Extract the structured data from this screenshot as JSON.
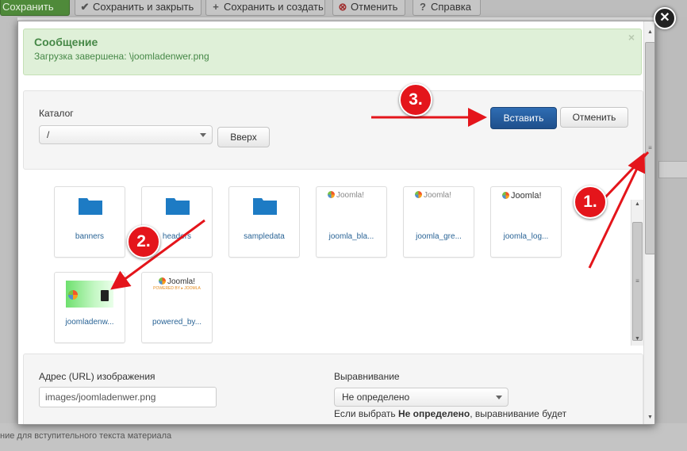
{
  "toolbar": {
    "save": "Сохранить",
    "save_close": "Сохранить и закрыть",
    "save_create": "Сохранить и создать",
    "cancel": "Отменить",
    "help": "Справка"
  },
  "background": {
    "bottom_caption": "ние для вступительного текста материала"
  },
  "message": {
    "title": "Сообщение",
    "text": "Загрузка завершена: \\joomladenwer.png",
    "close": "×"
  },
  "catalog": {
    "label": "Каталог",
    "selected": "/",
    "up_button": "Вверх",
    "insert_button": "Вставить",
    "cancel_button": "Отменить"
  },
  "files": [
    {
      "label": "banners",
      "type": "folder"
    },
    {
      "label": "headers",
      "type": "folder"
    },
    {
      "label": "sampledata",
      "type": "folder"
    },
    {
      "label": "joomla_bla...",
      "type": "image",
      "thumb": "Joomla!"
    },
    {
      "label": "joomla_gre...",
      "type": "image",
      "thumb": "Joomla!"
    },
    {
      "label": "joomla_log...",
      "type": "image",
      "thumb": "Joomla!"
    },
    {
      "label": "joomladenw...",
      "type": "image",
      "thumb": ""
    },
    {
      "label": "powered_by...",
      "type": "image",
      "thumb": "Joomla!"
    }
  ],
  "thumb_powered_sub": "POWERED BY ▸ JOOMLA",
  "image_url": {
    "label": "Адрес (URL) изображения",
    "value": "images/joomladenwer.png"
  },
  "alignment": {
    "label": "Выравнивание",
    "selected": "Не определено",
    "hint_prefix": "Если выбрать ",
    "hint_bold": "Не определено",
    "hint_suffix": ", выравнивание будет"
  },
  "annotations": [
    "1.",
    "2.",
    "3."
  ],
  "colors": {
    "primary_button": "#1e4f8c",
    "alert_bg": "#dff0d8",
    "alert_text": "#468847",
    "annotation_red": "#e4151b",
    "folder_blue": "#1d7bc4"
  },
  "icons": {
    "save_close": "check-icon",
    "save_create": "plus-icon",
    "cancel": "cancel-circle-icon",
    "help": "question-circle-icon",
    "modal_close": "close-icon",
    "folder": "folder-icon"
  }
}
